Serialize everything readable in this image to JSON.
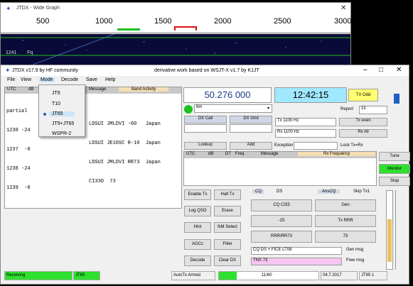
{
  "wide_graph": {
    "title": "JTDX - Wide Graph",
    "scale": [
      "500",
      "1000",
      "1500",
      "2000",
      "2500",
      "3000"
    ],
    "time_label": "1241",
    "time_label2": "Fq"
  },
  "main": {
    "title_left": "JTDX v17.9 by HF community",
    "title_center": "derivative work based on WSJT-X v1.7 by K1JT",
    "menu": [
      "File",
      "View",
      "Mode",
      "Decode",
      "Save",
      "Help"
    ],
    "mode_options": [
      "JT9",
      "T10",
      "JT65",
      "JT9+JT65",
      "WSPR-2"
    ],
    "selected_mode_index": 2,
    "band_activity_header": [
      "UTC",
      "dB",
      "Message",
      "Band Activity"
    ],
    "band_activity_lines": [
      "partial",
      "1230 -24",
      "1237  -0",
      "1238 -24",
      "1239  -0"
    ],
    "band_activity_msgs": [
      "",
      "LDSUI JMLDVI -00   Japan",
      "LDSUI JE10SC R-10  Japan",
      "LDSUI JMLDVI RR73  Japan",
      "CI33O  73"
    ],
    "frequency": "50.276 000",
    "clock": "12:42:15",
    "tx_odd": "TX Odd",
    "band": "6m",
    "dx_call_label": "DX Call",
    "dx_grid_label": "DX Grid",
    "tx_hz": "Tx 1100 Hz",
    "rx_hz": "Rx 1100 Hz",
    "report_label": "Report",
    "report_value": "15",
    "tx_even_btn": "Tx even",
    "rx_all_btn": "Rx All",
    "lookup_btn": "Lookup",
    "add_btn": "Add",
    "exception_label": "Exception",
    "lock_tx": "Lock Tx=Rx",
    "rx_header": [
      "UTC",
      "dB",
      "DT",
      "Freq",
      "Message",
      "Rx Frequency"
    ],
    "side_buttons": [
      "Tune",
      "Monitor",
      "Stop"
    ],
    "left_buttons": [
      [
        "Enable Tx",
        "Halt Tx"
      ],
      [
        "Log QSO",
        "Erase"
      ],
      [
        "Hint",
        "NM Select"
      ],
      [
        "AGCc",
        "Filter"
      ],
      [
        "Decode",
        "Clear DX"
      ]
    ],
    "tx_tabs": [
      "CQ",
      "DS",
      "AnsCQ",
      "Skip Tx1"
    ],
    "tx_msgs": [
      [
        "CQ CI33",
        "Gen"
      ],
      [
        "-15",
        "Tx RRR"
      ],
      [
        "RRR/RR73",
        "73"
      ],
      [
        "CQ DS + FICE LT08",
        "Gen msg"
      ]
    ],
    "free_msg": "TNX 73",
    "free_msg_label": "Free msg",
    "gen_msg_label": "Gen msg",
    "status": {
      "receiving": "Receiving",
      "mode": "JT65",
      "autotx": "AutoTx Armed",
      "progress_label": "11/60",
      "progress": 0.18,
      "date": "04.7.2017",
      "jtmode": "JT65 1"
    }
  }
}
